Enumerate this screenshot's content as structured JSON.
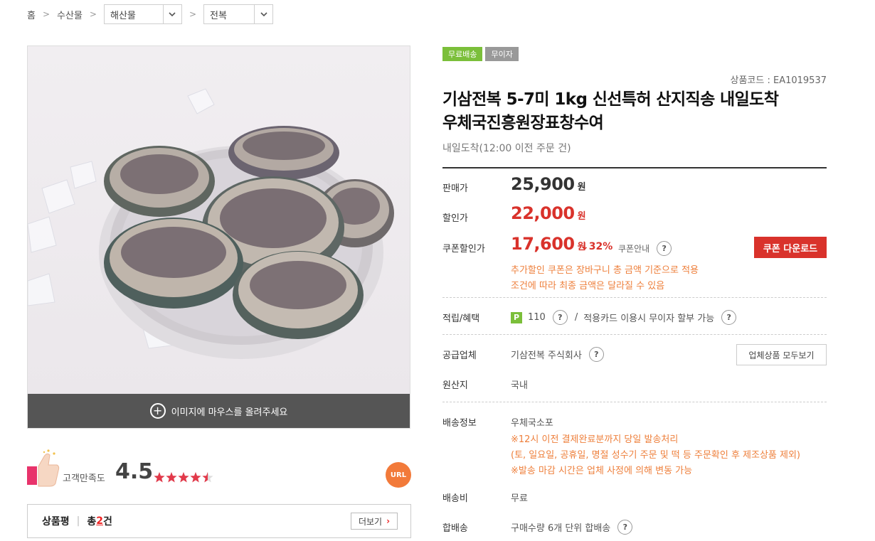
{
  "breadcrumb": {
    "home": "홈",
    "level1": "수산물",
    "level2": "해산물",
    "level3": "전복"
  },
  "image": {
    "hint": "이미지에 마우스를 올려주세요"
  },
  "satisfaction": {
    "label": "고객만족도",
    "score": "4.5",
    "rating": 4.5,
    "url_label": "URL"
  },
  "reviews": {
    "label": "상품평",
    "divider": "|",
    "total_prefix": "총 ",
    "count": "2",
    "total_suffix": "건",
    "more_label": "더보기"
  },
  "badges": [
    "무료배송",
    "무이자"
  ],
  "product": {
    "code": "상품코드 : EA1019537",
    "title_line1": "기삼전복 5-7미 1kg 신선특허 산지직송 내일도착",
    "title_line2": "우체국진흥원장표창수여",
    "subtitle": "내일도착(12:00 이전 주문 건)"
  },
  "prices": {
    "sale_label": "판매가",
    "sale_value": "25,900",
    "discount_label": "할인가",
    "discount_value": "22,000",
    "coupon_label": "쿠폰할인가",
    "coupon_value": "17,600",
    "won": "원",
    "rate": "32%",
    "coupon_info": "쿠폰안내",
    "coupon_button": "쿠폰 다운로드",
    "note_line1": "추가할인 쿠폰은 장바구니 총 금액 기준으로 적용",
    "note_line2": "조건에 따라 최종 금액은 달라질 수 있음"
  },
  "benefit": {
    "label": "적립/혜택",
    "points_badge": "P",
    "points": "110",
    "card_text": "적용카드 이용시 무이자 할부 가능"
  },
  "vendor": {
    "label": "공급업체",
    "name": "기삼전복 주식회사",
    "button": "업체상품 모두보기"
  },
  "origin": {
    "label": "원산지",
    "value": "국내"
  },
  "shipping": {
    "label": "배송정보",
    "carrier": "우체국소포",
    "note1": "※12시 이전 결제완료분까지 당일 발송처리",
    "note2": "(토, 일요일, 공휴일, 명절 성수기 주문 및 떡 등 주문확인 후 제조상품 제외)",
    "note3": "※발송 마감 시간은 업체 사정에 의해 변동 가능"
  },
  "fee": {
    "label": "배송비",
    "value": "무료"
  },
  "combined": {
    "label": "합배송",
    "value": "구매수량 6개 단위 합배송"
  }
}
